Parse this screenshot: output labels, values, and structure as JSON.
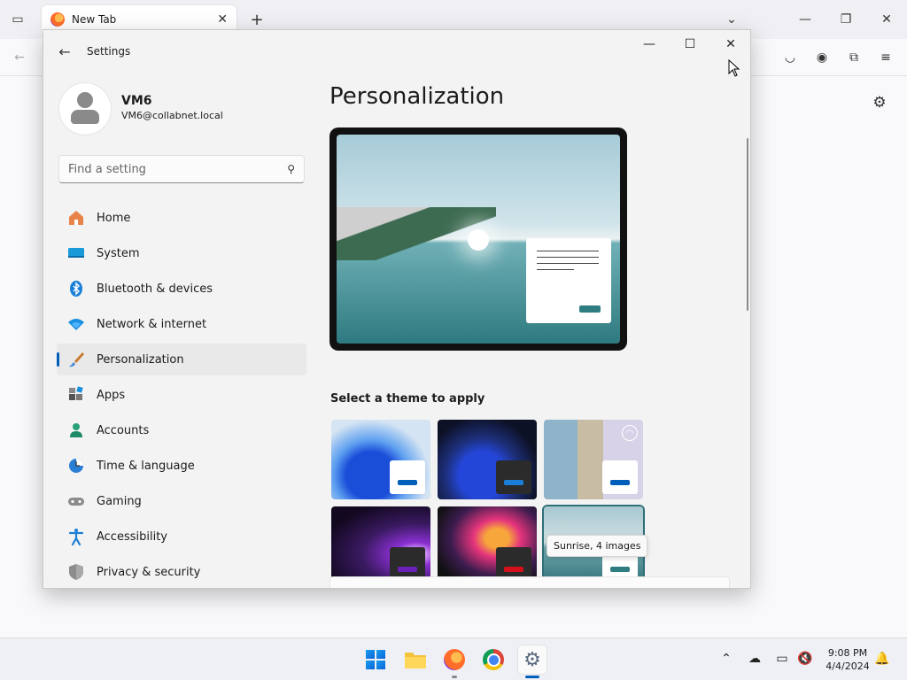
{
  "browser": {
    "tab_title": "New Tab",
    "close_tab_symbol": "✕",
    "new_tab_symbol": "+"
  },
  "settings": {
    "app_title": "Settings",
    "user": {
      "name": "VM6",
      "email": "VM6@collabnet.local"
    },
    "search": {
      "placeholder": "Find a setting"
    },
    "nav": [
      {
        "label": "Home",
        "icon": "home-icon"
      },
      {
        "label": "System",
        "icon": "system-icon"
      },
      {
        "label": "Bluetooth & devices",
        "icon": "bluetooth-icon"
      },
      {
        "label": "Network & internet",
        "icon": "wifi-icon"
      },
      {
        "label": "Personalization",
        "icon": "brush-icon",
        "active": true
      },
      {
        "label": "Apps",
        "icon": "apps-icon"
      },
      {
        "label": "Accounts",
        "icon": "accounts-icon"
      },
      {
        "label": "Time & language",
        "icon": "globe-clock-icon"
      },
      {
        "label": "Gaming",
        "icon": "gamepad-icon"
      },
      {
        "label": "Accessibility",
        "icon": "accessibility-icon"
      },
      {
        "label": "Privacy & security",
        "icon": "shield-icon"
      }
    ],
    "page_title": "Personalization",
    "themes_label": "Select a theme to apply",
    "tooltip": "Sunrise, 4 images",
    "accent_colors": {
      "blue": "#005fb8",
      "teal": "#2f7c81"
    }
  },
  "taskbar": {
    "time": "9:08 PM",
    "date": "4/4/2024"
  }
}
